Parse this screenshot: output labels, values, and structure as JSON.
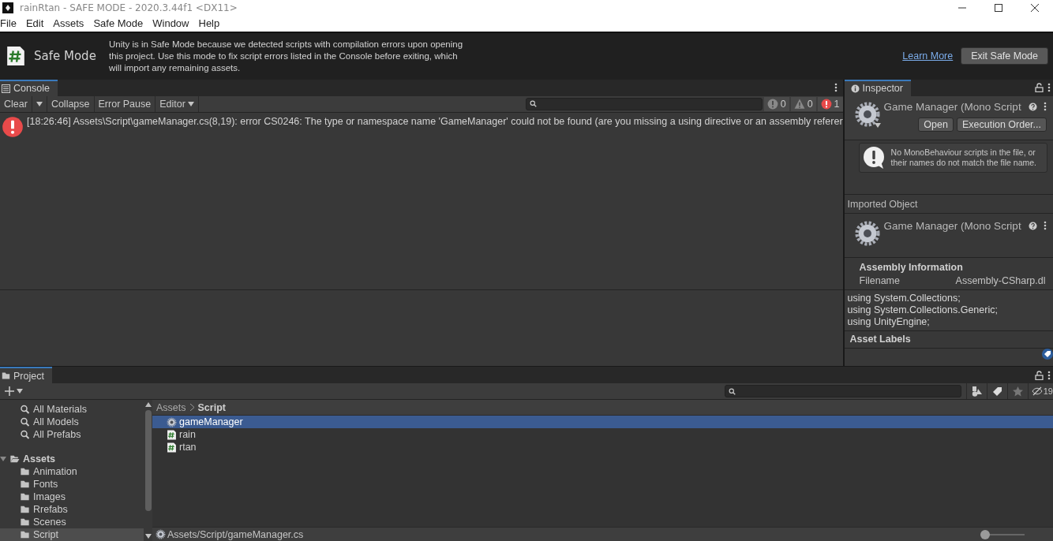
{
  "window": {
    "title": "rainRtan - SAFE MODE - 2020.3.44f1 <DX11>",
    "menu": [
      "File",
      "Edit",
      "Assets",
      "Safe Mode",
      "Window",
      "Help"
    ]
  },
  "safe_mode": {
    "title": "Safe Mode",
    "message": "Unity is in Safe Mode because we detected scripts with compilation errors upon opening this project. Use this mode to fix script errors listed in the Console before exiting, which will import any remaining assets.",
    "link": "Learn More",
    "button": "Exit Safe Mode"
  },
  "console": {
    "tab": "Console",
    "toolbar": [
      {
        "label": "Clear",
        "kind": "button"
      },
      {
        "kind": "dropdown"
      },
      {
        "label": "Collapse",
        "kind": "button"
      },
      {
        "label": "Error Pause",
        "kind": "button"
      },
      {
        "label": "Editor",
        "kind": "menu"
      }
    ],
    "counts": [
      {
        "kind": "info",
        "count": "0"
      },
      {
        "kind": "warning",
        "count": "0"
      },
      {
        "kind": "error",
        "count": "1"
      }
    ],
    "logs": [
      {
        "kind": "error",
        "text": "[18:26:46] Assets\\Script\\gameManager.cs(8,19): error CS0246: The type or namespace name 'GameManager' could not be found (are you missing a using directive or an assembly referer"
      }
    ]
  },
  "inspector": {
    "tab": "Inspector",
    "title": "Game Manager (Mono Script",
    "buttons": [
      "Open",
      "Execution Order..."
    ],
    "help": "No MonoBehaviour scripts in the file, or their names do not match the file name.",
    "imported_label": "Imported Object",
    "imported_title": "Game Manager (Mono Script",
    "section": "Assembly Information",
    "field_label": "Filename",
    "field_value": "Assembly-CSharp.dl",
    "code": [
      "using System.Collections;",
      "using System.Collections.Generic;",
      "using UnityEngine;"
    ],
    "labels_title": "Asset Labels"
  },
  "project": {
    "tab": "Project",
    "hidden_count": "19",
    "favorites": [
      "All Materials",
      "All Models",
      "All Prefabs"
    ],
    "tree": [
      {
        "name": "Assets",
        "expanded": true,
        "selected": false,
        "children": [
          {
            "name": "Animation",
            "selected": false
          },
          {
            "name": "Fonts",
            "selected": false
          },
          {
            "name": "Images",
            "selected": false
          },
          {
            "name": "Rrefabs",
            "selected": false
          },
          {
            "name": "Scenes",
            "selected": false
          },
          {
            "name": "Script",
            "selected": true
          }
        ]
      }
    ],
    "breadcrumb": [
      "Assets",
      "Script"
    ],
    "files": [
      {
        "name": "gameManager",
        "kind": "mono",
        "selected": true
      },
      {
        "name": "rain",
        "kind": "script",
        "selected": false
      },
      {
        "name": "rtan",
        "kind": "script",
        "selected": false
      }
    ],
    "status_path": "Assets/Script/gameManager.cs",
    "zoom": {
      "level": 0.0
    }
  }
}
